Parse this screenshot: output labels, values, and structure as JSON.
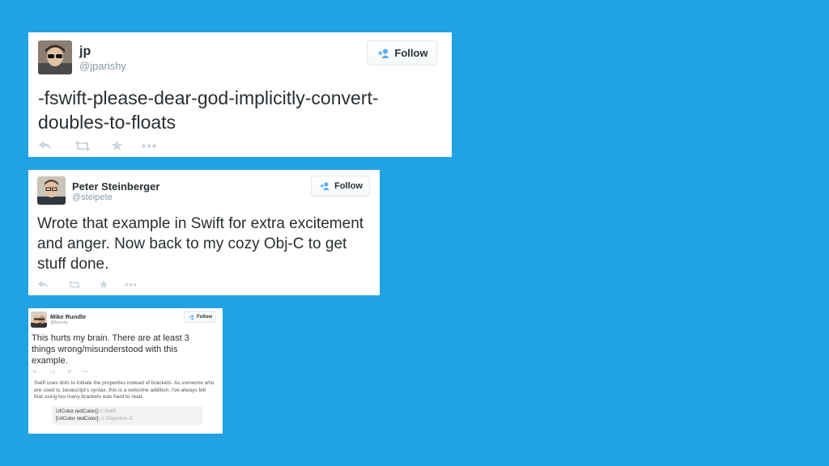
{
  "tweets": [
    {
      "name": "jp",
      "handle": "@jparishy",
      "follow_label": "Follow",
      "text": "-fswift-please-dear-god-implicitly-convert-doubles-to-floats"
    },
    {
      "name": "Peter Steinberger",
      "handle": "@steipete",
      "follow_label": "Follow",
      "text": "Wrote that example in Swift for extra excitement and anger. Now back to my cozy Obj-C to get stuff done."
    },
    {
      "name": "Mike Rundle",
      "handle": "@flyosity",
      "follow_label": "Follow",
      "text": "This hurts my brain. There are at least 3 things wrong/misunderstood with this example.",
      "explanation": "Swift uses dots to initiate the properties instead of brackets. As someone who are used to Javascript's syntax, this is a welcome addition. I've always felt that using too many brackets was hard to read.",
      "code": {
        "line1_code": "UIColor.redColor()",
        "line1_comment": "// Swift",
        "line2_code": "[UIColor redColor];",
        "line2_comment": "// Objective-C"
      }
    }
  ],
  "icons": [
    "reply-icon",
    "retweet-icon",
    "favorite-icon",
    "more-icon",
    "follow-person-icon"
  ],
  "colors": {
    "background": "#21a3e3",
    "follow_blue": "#55acee",
    "action_grey": "#ccd6dd"
  }
}
